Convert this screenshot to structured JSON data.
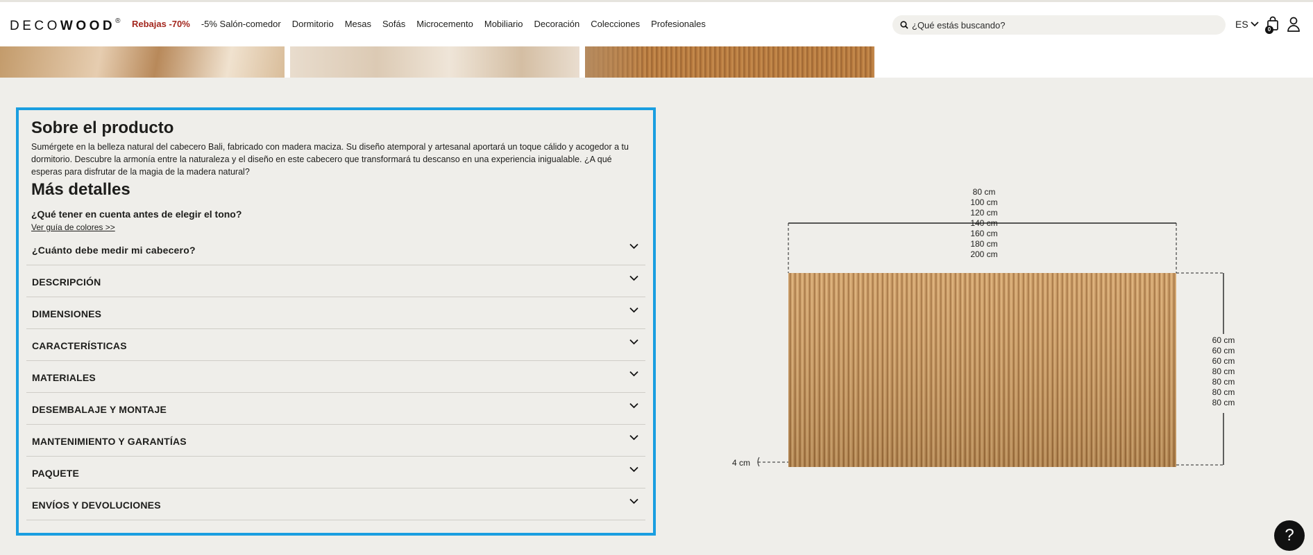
{
  "header": {
    "logo_light": "DECO",
    "logo_bold": "WOOD",
    "logo_mark": "®",
    "nav": [
      {
        "label": "Rebajas -70%",
        "sale": true
      },
      {
        "label": "-5% Salón-comedor"
      },
      {
        "label": "Dormitorio"
      },
      {
        "label": "Mesas"
      },
      {
        "label": "Sofás"
      },
      {
        "label": "Microcemento"
      },
      {
        "label": "Mobiliario"
      },
      {
        "label": "Decoración"
      },
      {
        "label": "Colecciones"
      },
      {
        "label": "Profesionales"
      }
    ],
    "search_placeholder": "¿Qué estás buscando?",
    "lang": "ES",
    "cart_count": "0"
  },
  "about": {
    "title": "Sobre el producto",
    "text": "Sumérgete en la belleza natural del cabecero Bali, fabricado con madera maciza. Su diseño atemporal y artesanal aportará un toque cálido y acogedor a tu dormitorio. Descubre la armonía entre la naturaleza y el diseño en este cabecero que transformará tu descanso en una experiencia inigualable. ¿A qué esperas para disfrutar de la magia de la madera natural?",
    "more_title": "Más detalles",
    "tone_question": "¿Qué tener en cuenta antes de elegir el tono?",
    "guide_link": "Ver guía de colores >>",
    "accordion": [
      {
        "label": "¿Cuánto debe medir mi cabecero?"
      },
      {
        "label": "DESCRIPCIÓN"
      },
      {
        "label": "DIMENSIONES"
      },
      {
        "label": "CARACTERÍSTICAS"
      },
      {
        "label": "MATERIALES"
      },
      {
        "label": "DESEMBALAJE Y MONTAJE"
      },
      {
        "label": "MANTENIMIENTO Y GARANTÍAS"
      },
      {
        "label": "PAQUETE"
      },
      {
        "label": "ENVÍOS Y DEVOLUCIONES"
      }
    ]
  },
  "diagram": {
    "widths": [
      "80 cm",
      "100 cm",
      "120 cm",
      "140 cm",
      "160 cm",
      "180 cm",
      "200 cm"
    ],
    "heights": [
      "60 cm",
      "60 cm",
      "60 cm",
      "80 cm",
      "80 cm",
      "80 cm",
      "80 cm"
    ],
    "depth": "4 cm"
  },
  "help_label": "?",
  "colors": {
    "accent_border": "#1a9ee0",
    "sale": "#a3261d",
    "wood": "#c9975e"
  }
}
